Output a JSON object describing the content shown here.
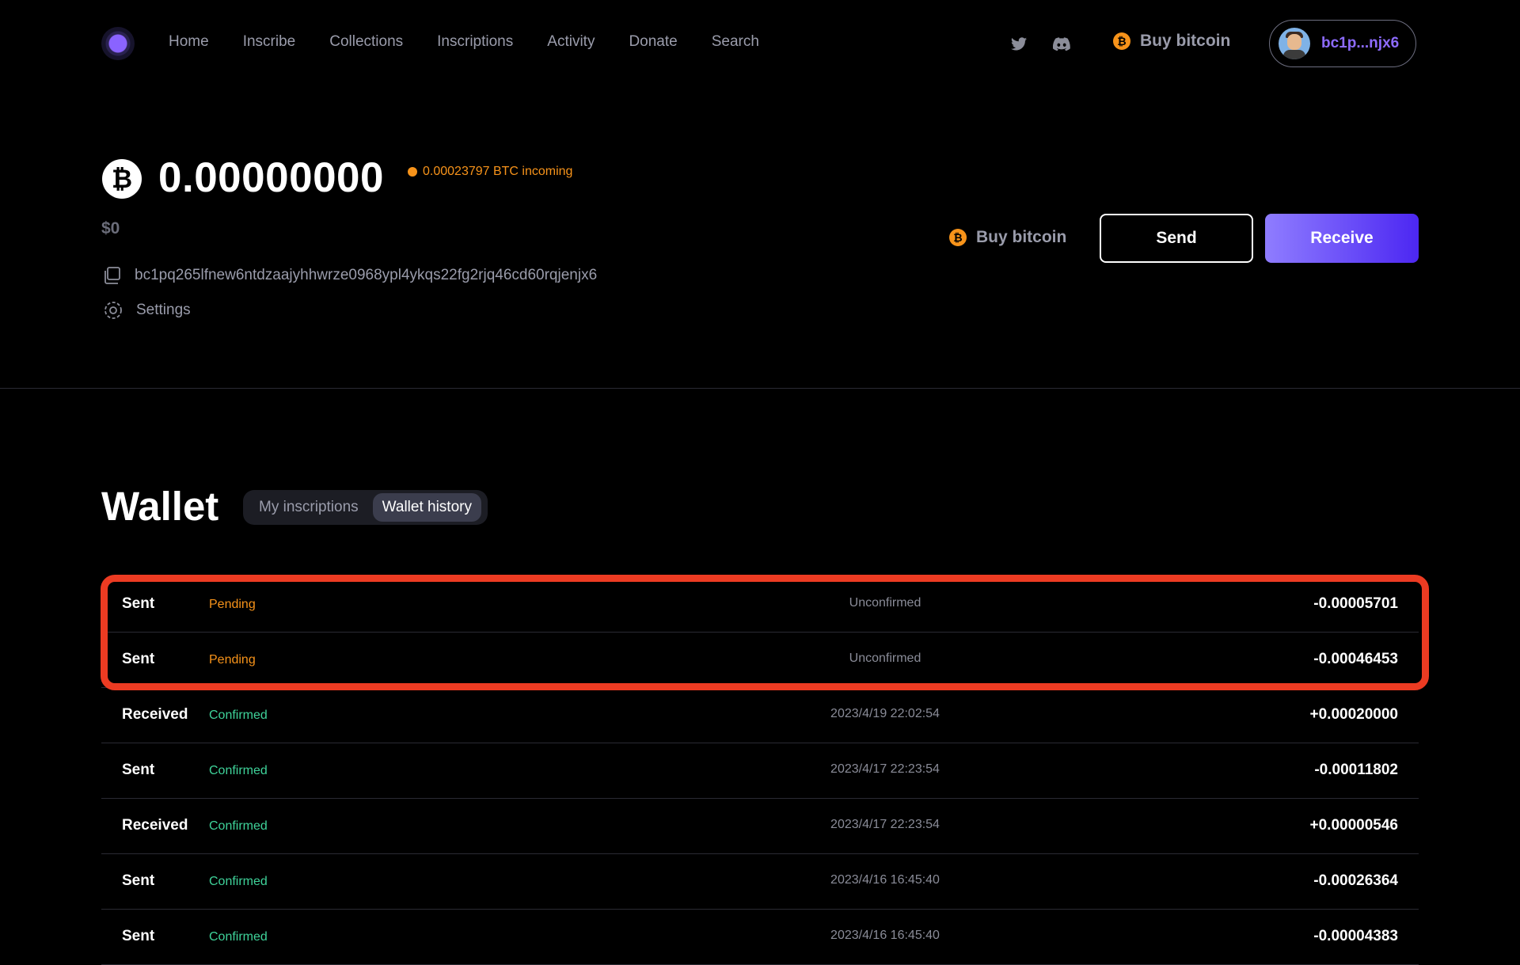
{
  "nav": {
    "links": [
      "Home",
      "Inscribe",
      "Collections",
      "Inscriptions",
      "Activity",
      "Donate",
      "Search"
    ],
    "buy_label": "Buy bitcoin",
    "account_label": "bc1p...njx6"
  },
  "balance": {
    "amount": "0.00000000",
    "incoming": "0.00023797 BTC incoming",
    "fiat": "$0",
    "address": "bc1pq265lfnew6ntdzaajyhhwrze0968ypl4ykqs22fg2rjq46cd60rqjenjx6",
    "settings_label": "Settings"
  },
  "actions": {
    "buy_label": "Buy bitcoin",
    "send_label": "Send",
    "receive_label": "Receive"
  },
  "wallet": {
    "title": "Wallet",
    "tabs": [
      "My inscriptions",
      "Wallet history"
    ],
    "active_tab": "Wallet history",
    "transactions": [
      {
        "type": "Sent",
        "status": "Pending",
        "time": "Unconfirmed",
        "amount": "-0.00005701"
      },
      {
        "type": "Sent",
        "status": "Pending",
        "time": "Unconfirmed",
        "amount": "-0.00046453"
      },
      {
        "type": "Received",
        "status": "Confirmed",
        "time": "2023/4/19 22:02:54",
        "amount": "+0.00020000"
      },
      {
        "type": "Sent",
        "status": "Confirmed",
        "time": "2023/4/17 22:23:54",
        "amount": "-0.00011802"
      },
      {
        "type": "Received",
        "status": "Confirmed",
        "time": "2023/4/17 22:23:54",
        "amount": "+0.00000546"
      },
      {
        "type": "Sent",
        "status": "Confirmed",
        "time": "2023/4/16 16:45:40",
        "amount": "-0.00026364"
      },
      {
        "type": "Sent",
        "status": "Confirmed",
        "time": "2023/4/16 16:45:40",
        "amount": "-0.00004383"
      }
    ]
  },
  "colors": {
    "accent": "#8d6bff",
    "bitcoin": "#f7931a",
    "confirmed": "#3fd39a",
    "highlight": "#ec3b22"
  }
}
